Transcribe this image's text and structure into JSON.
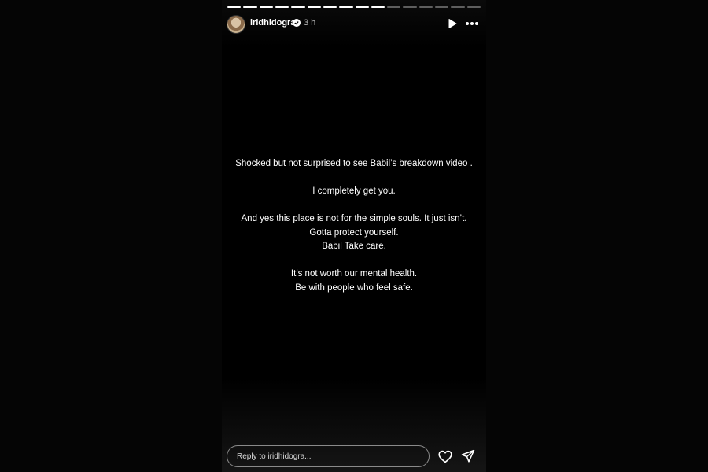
{
  "story": {
    "progress_total": 16,
    "progress_completed": 10,
    "username": "iridhidogra",
    "verified_icon": "verified-badge-icon",
    "time_ago": "3 h",
    "lines": [
      "Shocked but not surprised to see Babil’s breakdown video .",
      "I completely get you.",
      "And yes this place is not for the simple souls. It just isn’t. Gotta protect yourself.",
      "Babil Take care.",
      "It’s not worth our mental health.",
      "Be with people who feel safe."
    ],
    "reply_placeholder": "Reply to iridhidogra...",
    "icons": {
      "play": "play-icon",
      "more": "more-options-icon",
      "like": "heart-icon",
      "send": "send-icon"
    }
  },
  "colors": {
    "background": "#000000",
    "text": "#ffffff",
    "muted": "#bbbbbb"
  }
}
